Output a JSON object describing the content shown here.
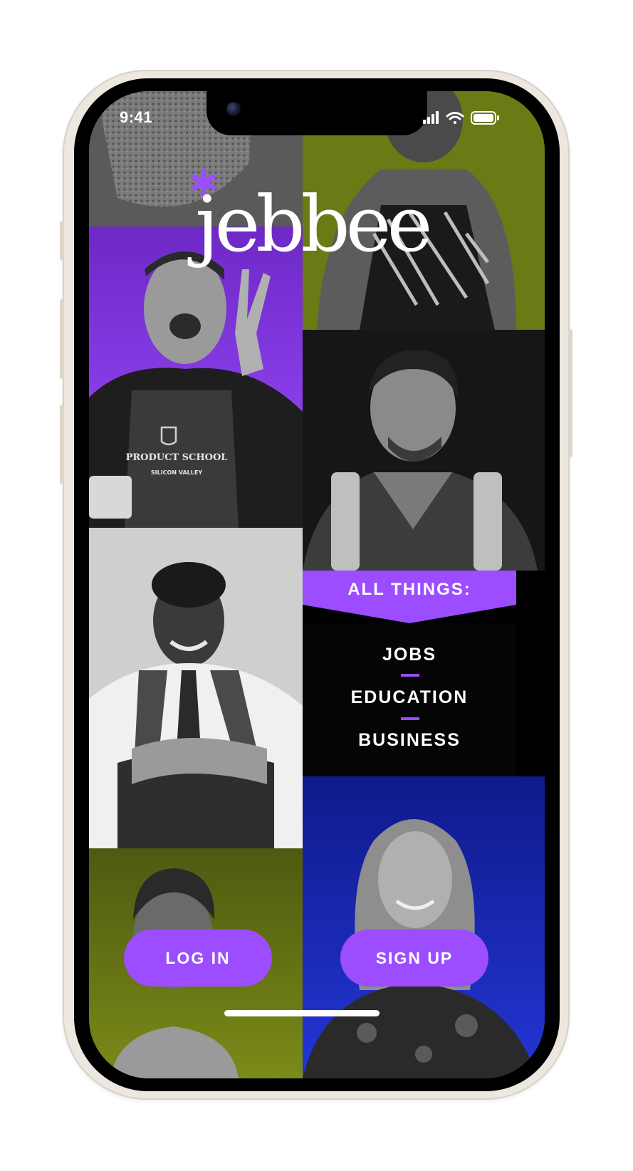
{
  "status_bar": {
    "time": "9:41"
  },
  "brand": {
    "logo_text": "jebbee",
    "accent": "#9b4dff"
  },
  "banner": {
    "label": "ALL THINGS:"
  },
  "topics": [
    "JOBS",
    "EDUCATION",
    "BUSINESS"
  ],
  "actions": {
    "login_label": "LOG IN",
    "signup_label": "SIGN UP"
  },
  "photo_tiles": [
    {
      "name": "photo-tile-top-left",
      "background": "#6e6e6e"
    },
    {
      "name": "photo-tile-top-right",
      "background": "#6b7a14"
    },
    {
      "name": "photo-tile-purple",
      "background": "#8a3df0"
    },
    {
      "name": "photo-tile-dark",
      "background": "#141414"
    },
    {
      "name": "photo-tile-grey",
      "background": "#c9c9c9"
    },
    {
      "name": "photo-tile-olive",
      "background": "#6b7a14"
    },
    {
      "name": "photo-tile-blue",
      "background": "#1a2bc4"
    }
  ],
  "icons": [
    "signal-icon",
    "wifi-icon",
    "battery-icon",
    "logo-asterisk-icon"
  ],
  "printed_text_in_photos": [
    "PRODUCT SCHOOL",
    "SILICON VALLEY"
  ]
}
